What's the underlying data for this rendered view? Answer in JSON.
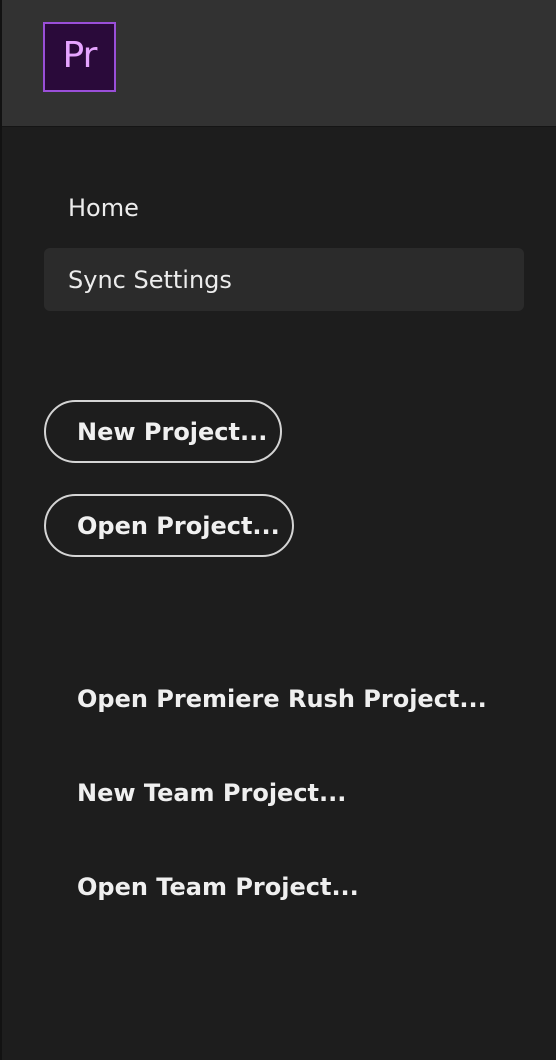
{
  "header": {
    "logo_text": "Pr"
  },
  "nav": {
    "home_label": "Home",
    "sync_label": "Sync Settings"
  },
  "actions": {
    "new_project_label": "New Project...",
    "open_project_label": "Open Project..."
  },
  "links": {
    "open_rush_label": "Open Premiere Rush Project...",
    "new_team_label": "New Team Project...",
    "open_team_label": "Open Team Project..."
  },
  "colors": {
    "accent_logo": "#9a4fd9",
    "logo_text": "#e6a5ff",
    "background": "#1d1d1d",
    "header_background": "#323232"
  }
}
